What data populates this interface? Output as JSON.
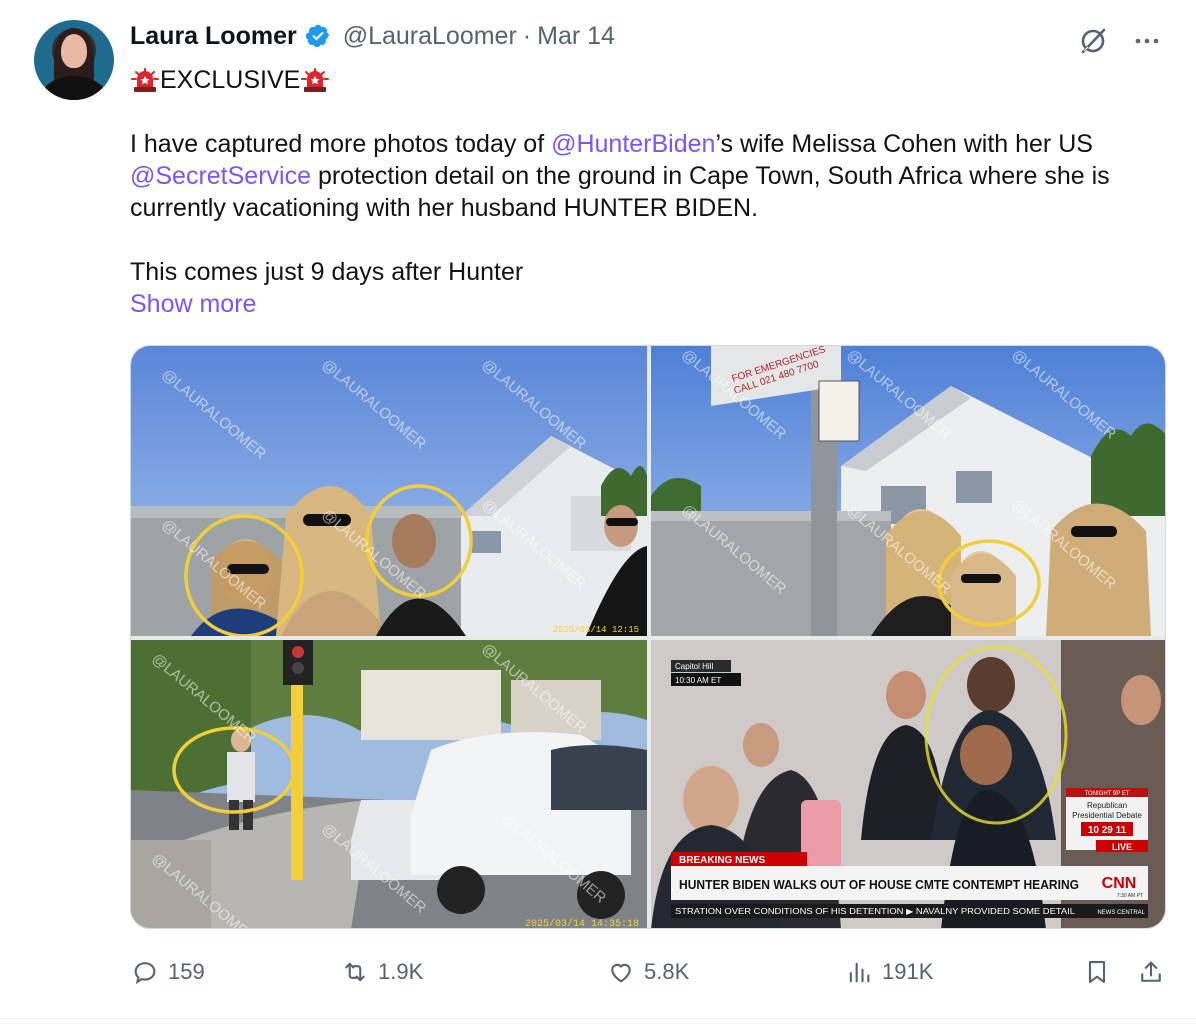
{
  "tweet": {
    "author_name": "Laura Loomer",
    "handle": "@LauraLoomer",
    "separator": "·",
    "date": "Mar 14",
    "headline": "EXCLUSIVE",
    "body": {
      "p1_a": "I have captured more photos today of ",
      "mention1": "@HunterBiden",
      "p1_b": "’s wife Melissa Cohen with her US ",
      "mention2": "@SecretService",
      "p1_c": " protection detail on the ground in Cape Town, South Africa where she is currently vacationing with her husband HUNTER BIDEN.",
      "p2": "This comes just 9 days after Hunter",
      "show_more": "Show more"
    },
    "media": {
      "watermark": "@LAURALOOMER",
      "img1_timestamp": "2025/03/14  12:15",
      "img2_sign_line1": "FOR EMERGENCIES",
      "img2_sign_line2": "CALL 021 480 7700",
      "img3_timestamp": "2025/03/14  14:35:18",
      "img4_location": "Capitol Hill",
      "img4_time": "10:30 AM ET",
      "img4_breaking": "BREAKING NEWS",
      "img4_headline": "HUNTER BIDEN WALKS OUT OF HOUSE CMTE CONTEMPT HEARING",
      "img4_network": "CNN",
      "img4_live": "LIVE",
      "img4_promo_top": "TONIGHT 9P ET",
      "img4_promo_1": "Republican",
      "img4_promo_2": "Presidential Debate",
      "img4_promo_date": "10 29 11",
      "img4_clock": "7:30 AM PT",
      "img4_ticker": "STRATION OVER CONDITIONS OF HIS DETENTION  ▶  NAVALNY PROVIDED SOME DETAIL",
      "img4_ticker_brand": "NEWS CENTRAL"
    },
    "stats": {
      "replies": "159",
      "reposts": "1.9K",
      "likes": "5.8K",
      "views": "191K"
    }
  },
  "colors": {
    "link": "#7856ff",
    "muted": "#536471",
    "verified": "#1d9bf0",
    "circle": "#f2cf3a"
  }
}
